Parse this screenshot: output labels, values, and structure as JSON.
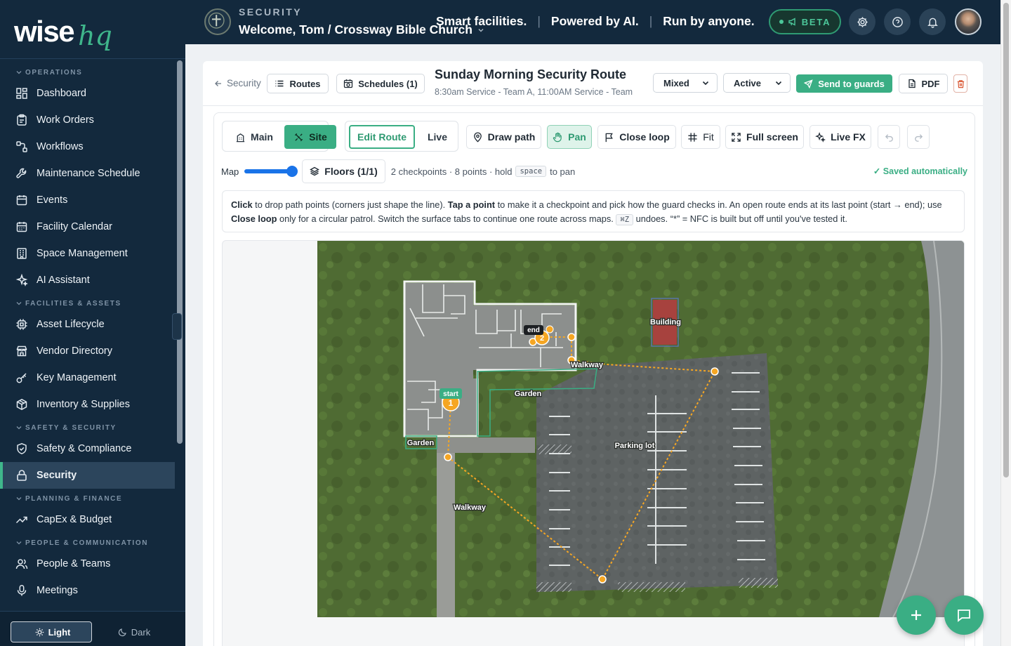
{
  "brand": {
    "wordmark": "wise",
    "suffix": "hq"
  },
  "sidebar": {
    "sections": [
      {
        "title": "OPERATIONS",
        "items": [
          {
            "label": "Dashboard",
            "icon": "dashboard-icon"
          },
          {
            "label": "Work Orders",
            "icon": "clipboard-icon"
          },
          {
            "label": "Workflows",
            "icon": "workflow-icon"
          },
          {
            "label": "Maintenance Schedule",
            "icon": "wrench-icon"
          },
          {
            "label": "Events",
            "icon": "calendar-icon"
          },
          {
            "label": "Facility Calendar",
            "icon": "calendar-grid-icon"
          },
          {
            "label": "Space Management",
            "icon": "building-icon"
          },
          {
            "label": "AI Assistant",
            "icon": "sparkles-icon"
          }
        ]
      },
      {
        "title": "FACILITIES & ASSETS",
        "items": [
          {
            "label": "Asset Lifecycle",
            "icon": "chip-icon"
          },
          {
            "label": "Vendor Directory",
            "icon": "store-icon"
          },
          {
            "label": "Key Management",
            "icon": "key-icon"
          },
          {
            "label": "Inventory & Supplies",
            "icon": "box-icon"
          }
        ]
      },
      {
        "title": "SAFETY & SECURITY",
        "items": [
          {
            "label": "Safety & Compliance",
            "icon": "shield-icon"
          },
          {
            "label": "Security",
            "icon": "lock-icon",
            "active": true
          }
        ]
      },
      {
        "title": "PLANNING & FINANCE",
        "items": [
          {
            "label": "CapEx & Budget",
            "icon": "trending-up-icon"
          }
        ]
      },
      {
        "title": "PEOPLE & COMMUNICATION",
        "items": [
          {
            "label": "People & Teams",
            "icon": "users-icon"
          },
          {
            "label": "Meetings",
            "icon": "microphone-icon"
          }
        ]
      }
    ],
    "theme": {
      "light": "Light",
      "dark": "Dark",
      "selected": "Light"
    }
  },
  "topbar": {
    "section": "SECURITY",
    "welcome": "Welcome, Tom / Crossway Bible Church",
    "tagline": [
      "Smart facilities.",
      "Powered by AI.",
      "Run by anyone."
    ],
    "beta": "BETA"
  },
  "header": {
    "back": "Security",
    "routes": "Routes",
    "schedules": "Schedules (1)",
    "title": "Sunday Morning Security Route",
    "subtitle": "8:30am Service - Team A, 11:00AM Service - Team",
    "mode_select": "Mixed",
    "status_select": "Active",
    "send": "Send to guards",
    "pdf": "PDF"
  },
  "editor": {
    "surface_tabs": {
      "main": "Main",
      "site": "Site",
      "selected": "Site"
    },
    "mode_tabs": {
      "edit": "Edit Route",
      "live": "Live",
      "selected": "Edit Route"
    },
    "tools": {
      "draw": "Draw path",
      "pan": "Pan",
      "close_loop": "Close loop",
      "fit": "Fit",
      "fullscreen": "Full screen",
      "live_fx": "Live FX"
    },
    "map_label": "Map",
    "map_opacity": 1.0,
    "floors": "Floors (1/1)",
    "summary": "2 checkpoints · 8 points · hold",
    "key": "space",
    "summary_tail": "to pan",
    "saved": "✓ Saved automatically",
    "help": {
      "p1b": "Click",
      "p1": " to drop path points (corners just shape the line). ",
      "p2b": "Tap a point",
      "p2": " to make it a checkpoint and pick how the guard checks in. An open route ends at its last point (start → end); use ",
      "p3b": "Close loop",
      "p3": " only for a circular patrol. Switch the surface tabs to continue one route across maps. ",
      "key": "⌘Z",
      "p4": " undoes. “*” = NFC is built but off until you've tested it."
    },
    "map_labels": {
      "building": "Building",
      "walkway1": "Walkway",
      "walkway2": "Walkway",
      "garden1": "Garden",
      "garden2": "Garden",
      "parking": "Parking lot",
      "start": "start",
      "end": "end",
      "cp1": "1",
      "cp2": "2"
    }
  },
  "colors": {
    "accent": "#3aae84",
    "sidebar": "#13293d",
    "route": "#f5a623"
  }
}
